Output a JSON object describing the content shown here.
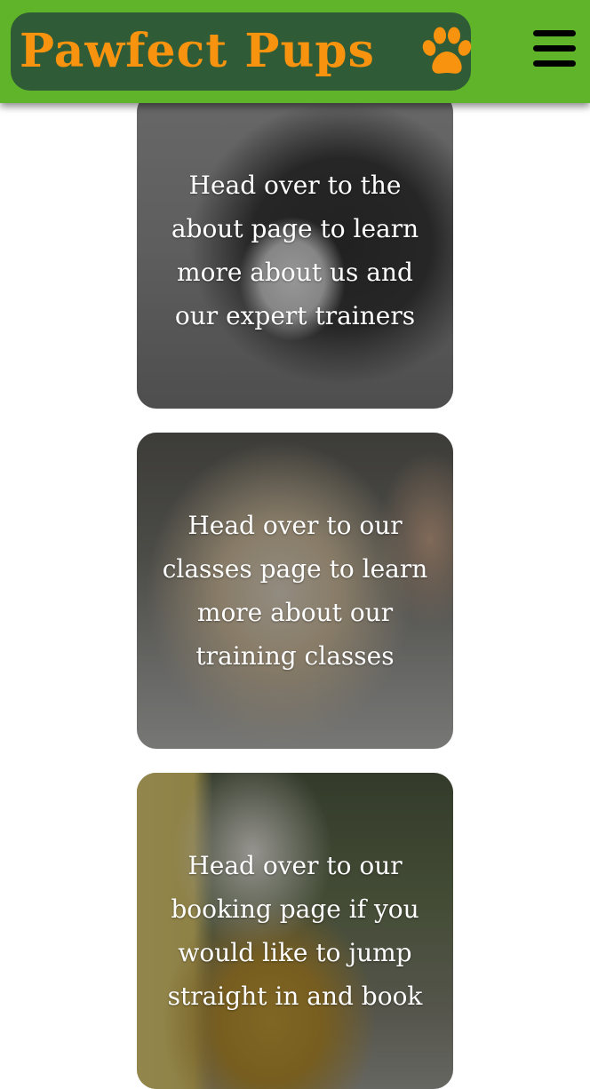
{
  "header": {
    "logo_text": "Pawfect Pups",
    "logo_icon": "paw-icon",
    "menu_icon": "hamburger-menu-icon"
  },
  "cards": [
    {
      "caption": "Head over to the about page to learn more about us and our expert trainers",
      "image": "border-collie-photo"
    },
    {
      "caption": "Head over to our classes page to learn more about our training classes",
      "image": "golden-retriever-photo"
    },
    {
      "caption": "Head over to our booking page if you would like to jump straight in and book",
      "image": "white-dog-yellow-raincoat-photo"
    }
  ],
  "colors": {
    "header_background": "#5fb42a",
    "logo_background": "#2f5b36",
    "logo_text": "#f7930e"
  }
}
